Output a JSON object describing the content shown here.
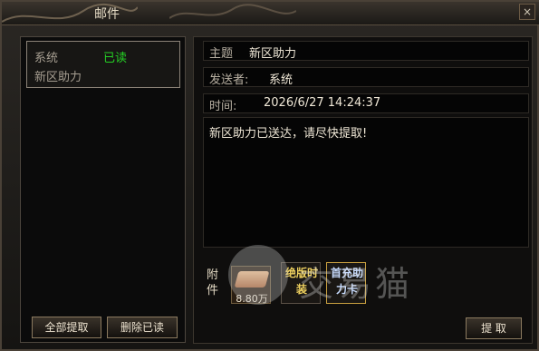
{
  "window": {
    "title": "邮件",
    "close_label": "×"
  },
  "mail_list": {
    "items": [
      {
        "from": "系统",
        "status": "已读",
        "subject": "新区助力"
      }
    ],
    "buttons": {
      "take_all": "全部提取",
      "delete_read": "删除已读"
    }
  },
  "mail": {
    "subject_label": "主题",
    "subject": "新区助力",
    "sender_label": "发送者:",
    "sender": "系统",
    "time_label": "时间:",
    "time": "2026/6/27 14:24:37",
    "body": "新区助力已送达，请尽快提取!",
    "attachment_label": "附件",
    "attachments": [
      {
        "name": "gold",
        "amount": "8.80万"
      },
      {
        "name": "绝版时装"
      },
      {
        "name": "首充助力卡"
      }
    ],
    "take_button": "提 取"
  },
  "watermark": {
    "text": "交易猫"
  },
  "colors": {
    "read_status": "#25d025",
    "accent_gold": "#f0d260"
  }
}
